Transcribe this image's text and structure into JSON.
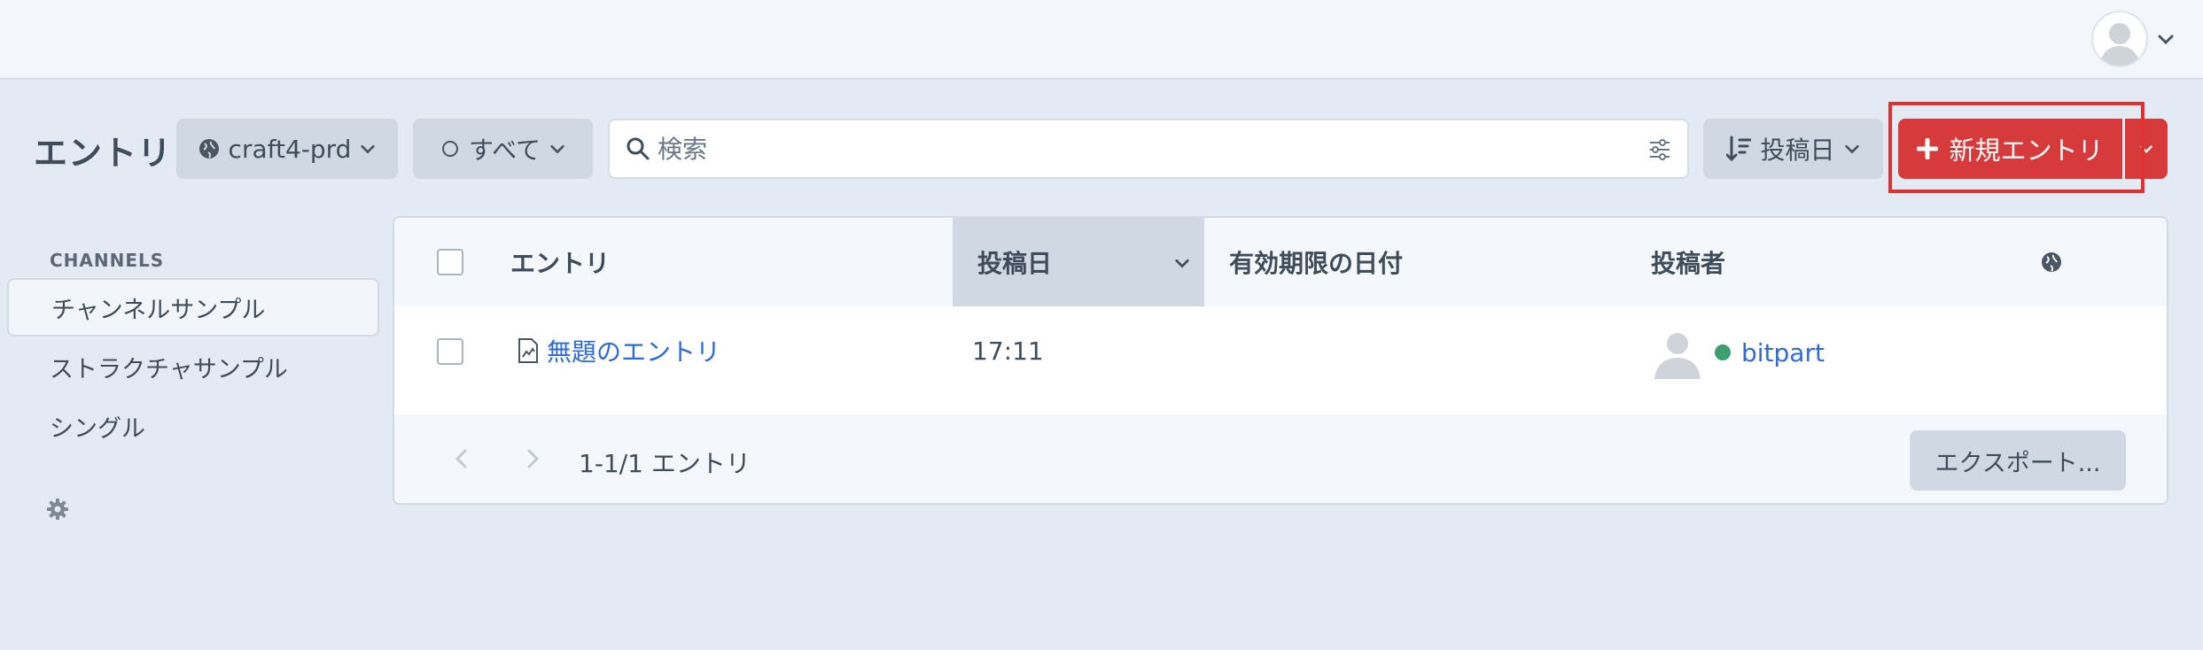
{
  "header": {
    "user_menu_icon": "user-avatar-icon"
  },
  "toolbar": {
    "title": "エントリ",
    "site_select": "craft4-prd",
    "status_select": "すべて",
    "search_placeholder": "検索",
    "sort_label": "投稿日",
    "new_entry_label": "新規エントリ"
  },
  "sidebar": {
    "heading": "CHANNELS",
    "items": [
      {
        "label": "チャンネルサンプル",
        "selected": true
      },
      {
        "label": "ストラクチャサンプル",
        "selected": false
      },
      {
        "label": "シングル",
        "selected": false
      }
    ]
  },
  "table": {
    "columns": [
      "エントリ",
      "投稿日",
      "有効期限の日付",
      "投稿者"
    ],
    "sorted_column": "投稿日",
    "rows": [
      {
        "title": "無題のエントリ",
        "post_date": "17:11",
        "expiry_date": "",
        "author": "bitpart",
        "author_status_color": "#3d9e70"
      }
    ],
    "footer": {
      "count": "1-1/1 エントリ",
      "export_label": "エクスポート..."
    }
  },
  "colors": {
    "accent": "#d63a3a",
    "link": "#2f6ad6",
    "background": "#e4eaf3"
  }
}
